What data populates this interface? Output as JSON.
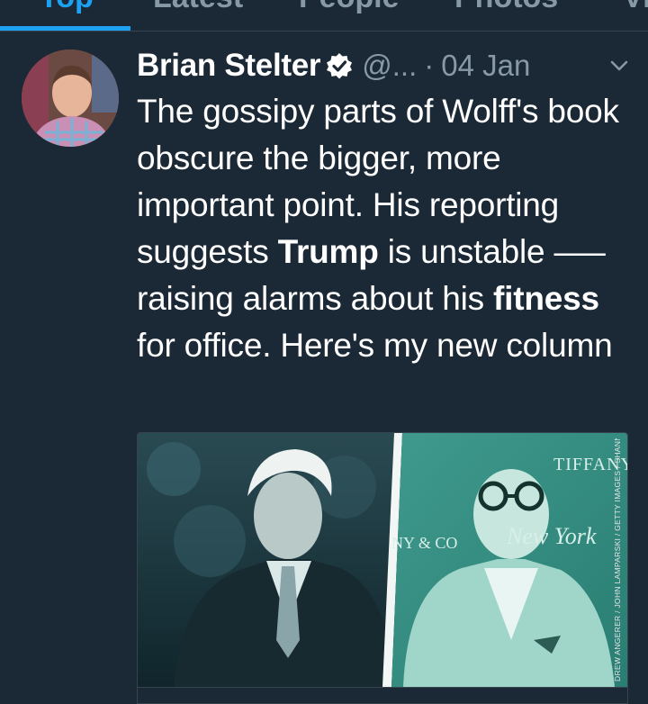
{
  "tabs": [
    {
      "label": "Top",
      "active": true
    },
    {
      "label": "Latest"
    },
    {
      "label": "People"
    },
    {
      "label": "Photos"
    },
    {
      "label": "Videos"
    }
  ],
  "tweet": {
    "author_name": "Brian Stelter",
    "verified": true,
    "handle": "@...",
    "separator": "·",
    "date": "04 Jan",
    "text_segments": [
      {
        "text": "The gossipy parts of Wolff's book obscure the bigger, more important point. His reporting suggests ",
        "bold": false
      },
      {
        "text": "Trump",
        "bold": true
      },
      {
        "text": " is unstable —– raising alarms about his ",
        "bold": false
      },
      {
        "text": "fitness",
        "bold": true
      },
      {
        "text": " for office. Here's my new column",
        "bold": false
      }
    ]
  },
  "card": {
    "sign_tiffany": "TIFFANY",
    "sign_new_york": "New York",
    "sign_ny_co": "NY & CO",
    "photo_credit": "DREW ANGERER / JOHN LAMPARSKI / GETTY IMAGES / SHANNON"
  },
  "colors": {
    "background": "#1b2836",
    "accent": "#1da1f2",
    "secondary_text": "#8899a6",
    "duotone": "#2e7b73"
  },
  "icons": {
    "verified": "verified-badge-icon",
    "caret": "chevron-down-icon"
  }
}
